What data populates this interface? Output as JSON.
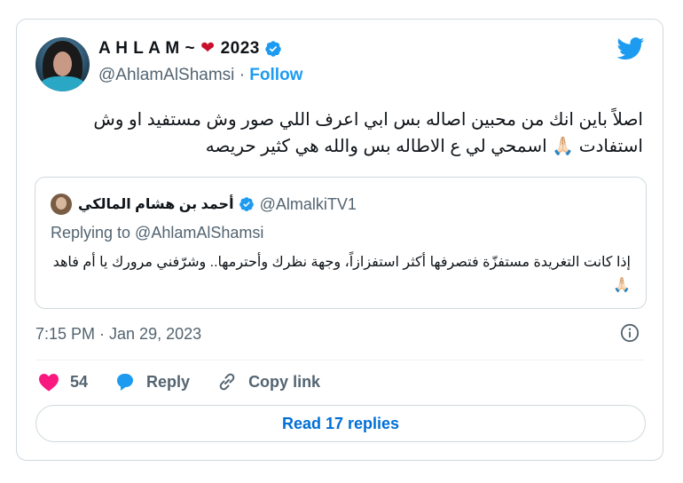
{
  "author": {
    "name_prefix": "A H L A M ~",
    "heart_emoji": "❤",
    "name_suffix": "2023",
    "handle": "@AhlamAlShamsi",
    "separator": "·",
    "follow_label": "Follow"
  },
  "tweet": {
    "text": "اصلاً باين انك من محبين اصاله بس ابي اعرف اللي صور وش مستفيد او وش استفادت 🙏🏻 اسمحي لي ع الاطاله بس والله هي كثير حريصه"
  },
  "quote": {
    "name": "أحمد بن هشام المالكي",
    "handle": "@AlmalkiTV1",
    "replying_to": "Replying to @AhlamAlShamsi",
    "text": "إذا كانت التغريدة مستفزّة فتصرفها أكثر استفزازاً، وجهة نظرك وأحترمها.. وشرّفني مرورك يا أم فاهد 🙏🏻"
  },
  "meta": {
    "timestamp": "7:15 PM · Jan 29, 2023"
  },
  "actions": {
    "like_count": "54",
    "reply_label": "Reply",
    "copy_link_label": "Copy link"
  },
  "footer": {
    "read_replies_label": "Read 17 replies"
  },
  "colors": {
    "accent": "#1d9bf0",
    "like": "#f91880",
    "reply": "#1d9bf0",
    "heart_emoji": "#c8102e"
  },
  "icons": [
    "verified-badge-icon",
    "twitter-bird-icon",
    "info-icon",
    "heart-icon",
    "reply-bubble-icon",
    "link-icon"
  ]
}
